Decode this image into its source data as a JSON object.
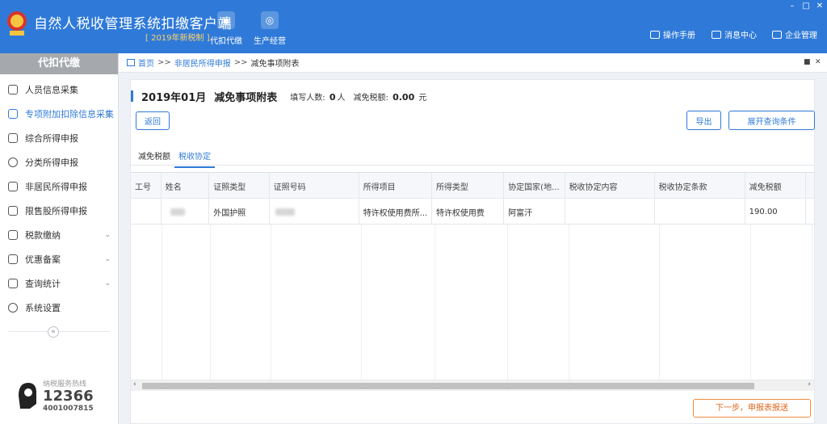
{
  "app": {
    "title": "自然人税收管理系统扣缴客户端",
    "subtitle": "[ 2019年新税制 ]",
    "nav": [
      {
        "label": "代扣代缴",
        "icon": "wallet-icon"
      },
      {
        "label": "生产经营",
        "icon": "coins-icon"
      }
    ],
    "links": [
      {
        "label": "操作手册",
        "icon": "manual-icon"
      },
      {
        "label": "消息中心",
        "icon": "mail-icon"
      },
      {
        "label": "企业管理",
        "icon": "building-icon"
      }
    ]
  },
  "sidebar": {
    "header": "代扣代缴",
    "items": [
      {
        "label": "人员信息采集"
      },
      {
        "label": "专项附加扣除信息采集",
        "arrow": "⌄"
      },
      {
        "label": "综合所得申报"
      },
      {
        "label": "分类所得申报"
      },
      {
        "label": "非居民所得申报"
      },
      {
        "label": "限售股所得申报"
      },
      {
        "label": "税款缴纳",
        "arrow": "⌄"
      },
      {
        "label": "优惠备案",
        "arrow": "⌄"
      },
      {
        "label": "查询统计",
        "arrow": "⌄"
      },
      {
        "label": "系统设置"
      }
    ],
    "hotline": {
      "label": "纳税服务热线",
      "number": "12366",
      "number2": "4001007815"
    }
  },
  "breadcrumb": {
    "home": "首页",
    "sep": ">>",
    "parent": "非居民所得申报",
    "current": "减免事项附表"
  },
  "summary": {
    "period": "2019年01月",
    "table_name": "减免事项附表",
    "fill_count_label": "填写人数:",
    "fill_count_value": "0",
    "fill_count_unit": "人",
    "tax_label": "减免税额:",
    "tax_value": "0.00",
    "tax_unit": "元"
  },
  "buttons": {
    "back": "返回",
    "export": "导出",
    "expand": "展开查询条件",
    "next": "下一步，申报表报送"
  },
  "tabs": [
    {
      "label": "减免税额"
    },
    {
      "label": "税收协定"
    }
  ],
  "table": {
    "columns": [
      "工号",
      "姓名",
      "证照类型",
      "证照号码",
      "所得项目",
      "所得类型",
      "协定国家(地...",
      "税收协定内容",
      "税收协定条款",
      "减免税额"
    ],
    "rows": [
      [
        "",
        "",
        "外国护照",
        "",
        "特许权使用费所...",
        "特许权使用费",
        "阿富汗",
        "",
        "",
        "190.00"
      ]
    ]
  }
}
